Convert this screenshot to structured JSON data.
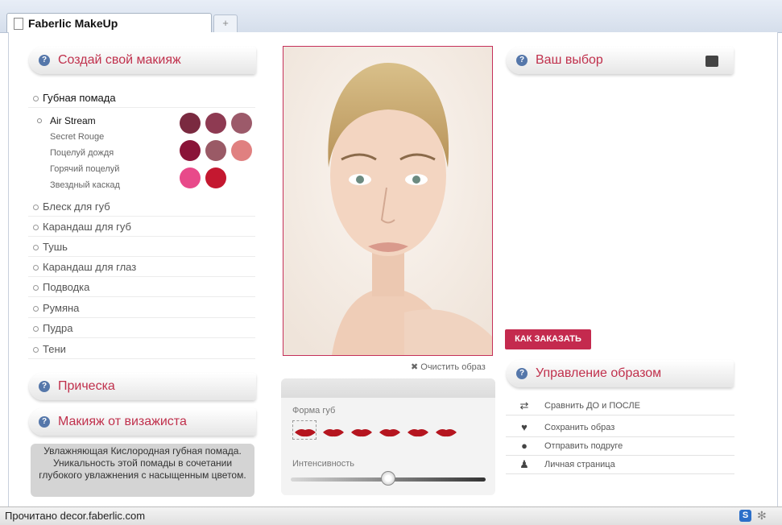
{
  "browser": {
    "tab_title": "Faberlic MakeUp",
    "new_tab": "+",
    "status": "Прочитано decor.faberlic.com",
    "status_icon": "S"
  },
  "left": {
    "create_title": "Создай свой макияж",
    "menu": [
      "Губная помада",
      "Блеск для губ",
      "Карандаш для губ",
      "Тушь",
      "Карандаш для глаз",
      "Подводка",
      "Румяна",
      "Пудра",
      "Тени"
    ],
    "lipstick_lines": [
      "Air Stream",
      "Secret Rouge",
      "Поцелуй дождя",
      "Горячий поцелуй",
      "Звездный каскад"
    ],
    "swatches": [
      "#7a2a40",
      "#8e3a52",
      "#9c5a6a",
      "#8a1438",
      "#9a5a66",
      "#e08080",
      "#e84a8a",
      "#c41830"
    ],
    "hairstyle_title": "Прическа",
    "artist_title": "Макияж от визажиста",
    "description": "Увлажняющая Кислородная губная помада. Уникальность этой помады в сочетании глубокого увлажнения с насыщенным цветом."
  },
  "center": {
    "clear_label": "✖ Очистить образ",
    "lip_shape_label": "Форма губ",
    "intensity_label": "Интенсивность",
    "intensity_value": 0.5,
    "lip_color": "#b5151f"
  },
  "right": {
    "choice_title": "Ваш выбор",
    "order_button": "КАК ЗАКАЗАТЬ",
    "manage_title": "Управление образом",
    "actions": [
      {
        "icon": "compare-arrows-icon",
        "label": "Сравнить ДО и ПОСЛЕ"
      },
      {
        "icon": "heart-icon",
        "label": "Сохранить образ"
      },
      {
        "icon": "speech-bubble-icon",
        "label": "Отправить подруге"
      },
      {
        "icon": "person-icon",
        "label": "Личная страница"
      }
    ]
  }
}
